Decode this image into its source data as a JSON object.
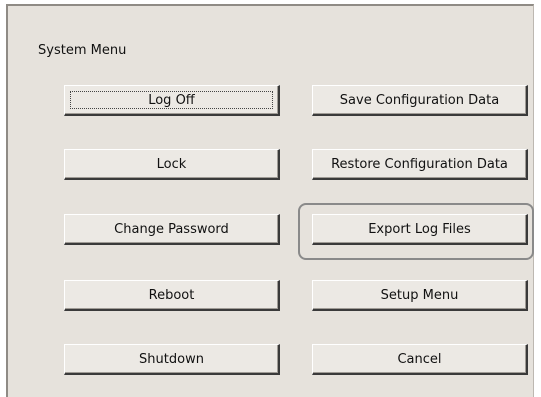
{
  "dialog": {
    "title": "System Menu"
  },
  "buttons": {
    "log_off": "Log Off",
    "lock": "Lock",
    "change_password": "Change Password",
    "reboot": "Reboot",
    "shutdown": "Shutdown",
    "save_configuration_data": "Save Configuration Data",
    "restore_configuration_data": "Restore Configuration Data",
    "export_log_files": "Export Log Files",
    "setup_menu": "Setup Menu",
    "cancel": "Cancel"
  },
  "colors": {
    "dialog_background": "#e6e2dc",
    "button_face": "#ece9e4",
    "highlight_outline": "#8a8a8a"
  }
}
